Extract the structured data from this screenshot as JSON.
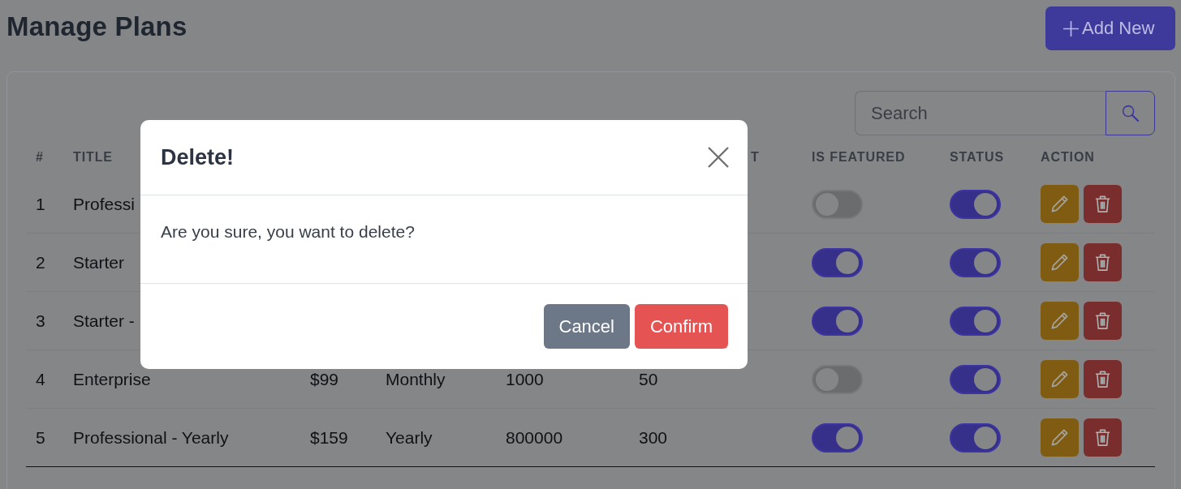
{
  "page": {
    "title": "Manage Plans"
  },
  "add_button": {
    "label": "Add New"
  },
  "search": {
    "placeholder": "Search"
  },
  "table": {
    "columns": {
      "number": "#",
      "title": "TITLE",
      "column_6": "T",
      "is_featured": "IS FEATURED",
      "status": "STATUS",
      "action": "ACTION"
    },
    "rows": [
      {
        "number": "1",
        "title": "Professi",
        "is_featured": false,
        "status": true
      },
      {
        "number": "2",
        "title": "Starter",
        "is_featured": true,
        "status": true
      },
      {
        "number": "3",
        "title": "Starter -",
        "is_featured": true,
        "status": true
      },
      {
        "number": "4",
        "title": "Enterprise",
        "column_3": "$99",
        "column_4": "Monthly",
        "column_5": "1000",
        "column_6": "50",
        "is_featured": false,
        "status": true
      },
      {
        "number": "5",
        "title": "Professional - Yearly",
        "column_3": "$159",
        "column_4": "Yearly",
        "column_5": "800000",
        "column_6": "300",
        "is_featured": true,
        "status": true
      }
    ]
  },
  "modal": {
    "title": "Delete!",
    "message": "Are you sure, you want to delete?",
    "buttons": [
      {
        "kind": "secondary",
        "label": "Cancel"
      },
      {
        "kind": "danger",
        "label": "Confirm"
      }
    ]
  }
}
